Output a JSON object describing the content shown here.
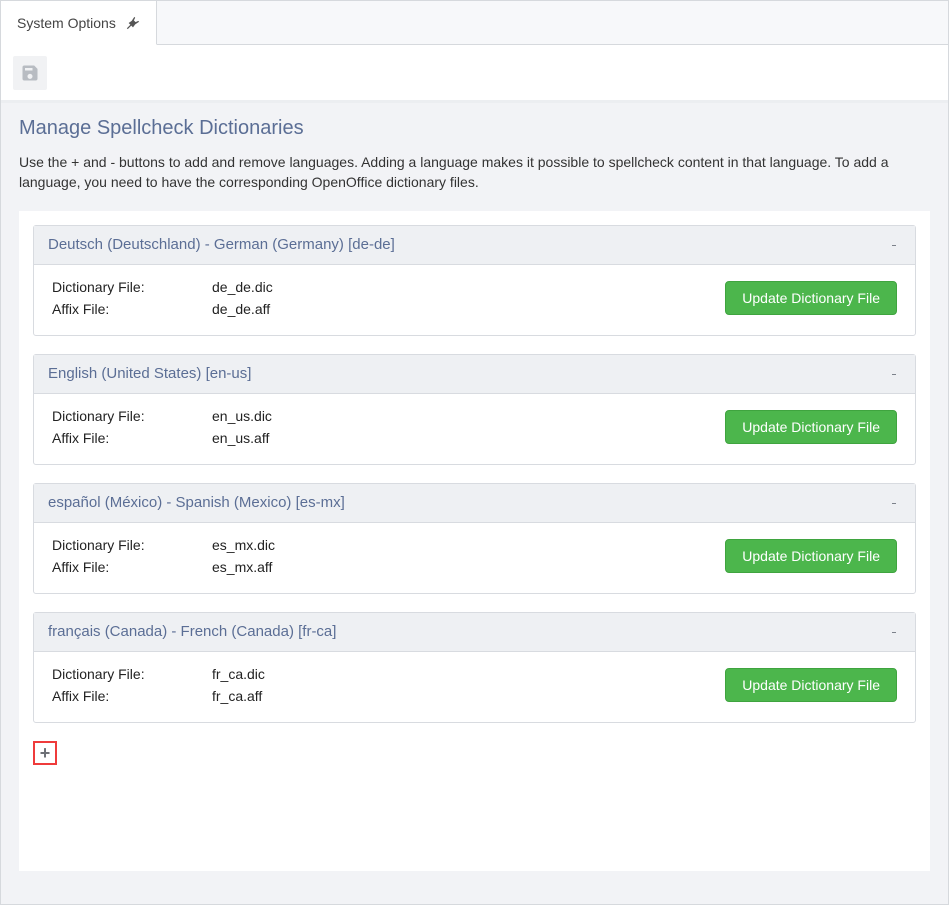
{
  "tab": {
    "label": "System Options"
  },
  "page": {
    "title": "Manage Spellcheck Dictionaries",
    "description": "Use the + and - buttons to add and remove languages. Adding a language makes it possible to spellcheck content in that language. To add a language, you need to have the corresponding OpenOffice dictionary files."
  },
  "labels": {
    "dict_file": "Dictionary File:",
    "affix_file": "Affix File:",
    "update_btn": "Update Dictionary File"
  },
  "languages": [
    {
      "title": "Deutsch (Deutschland) - German (Germany) [de-de]",
      "dict": "de_de.dic",
      "affix": "de_de.aff"
    },
    {
      "title": "English (United States) [en-us]",
      "dict": "en_us.dic",
      "affix": "en_us.aff"
    },
    {
      "title": "español (México) - Spanish (Mexico) [es-mx]",
      "dict": "es_mx.dic",
      "affix": "es_mx.aff"
    },
    {
      "title": "français (Canada) - French (Canada) [fr-ca]",
      "dict": "fr_ca.dic",
      "affix": "fr_ca.aff"
    }
  ]
}
